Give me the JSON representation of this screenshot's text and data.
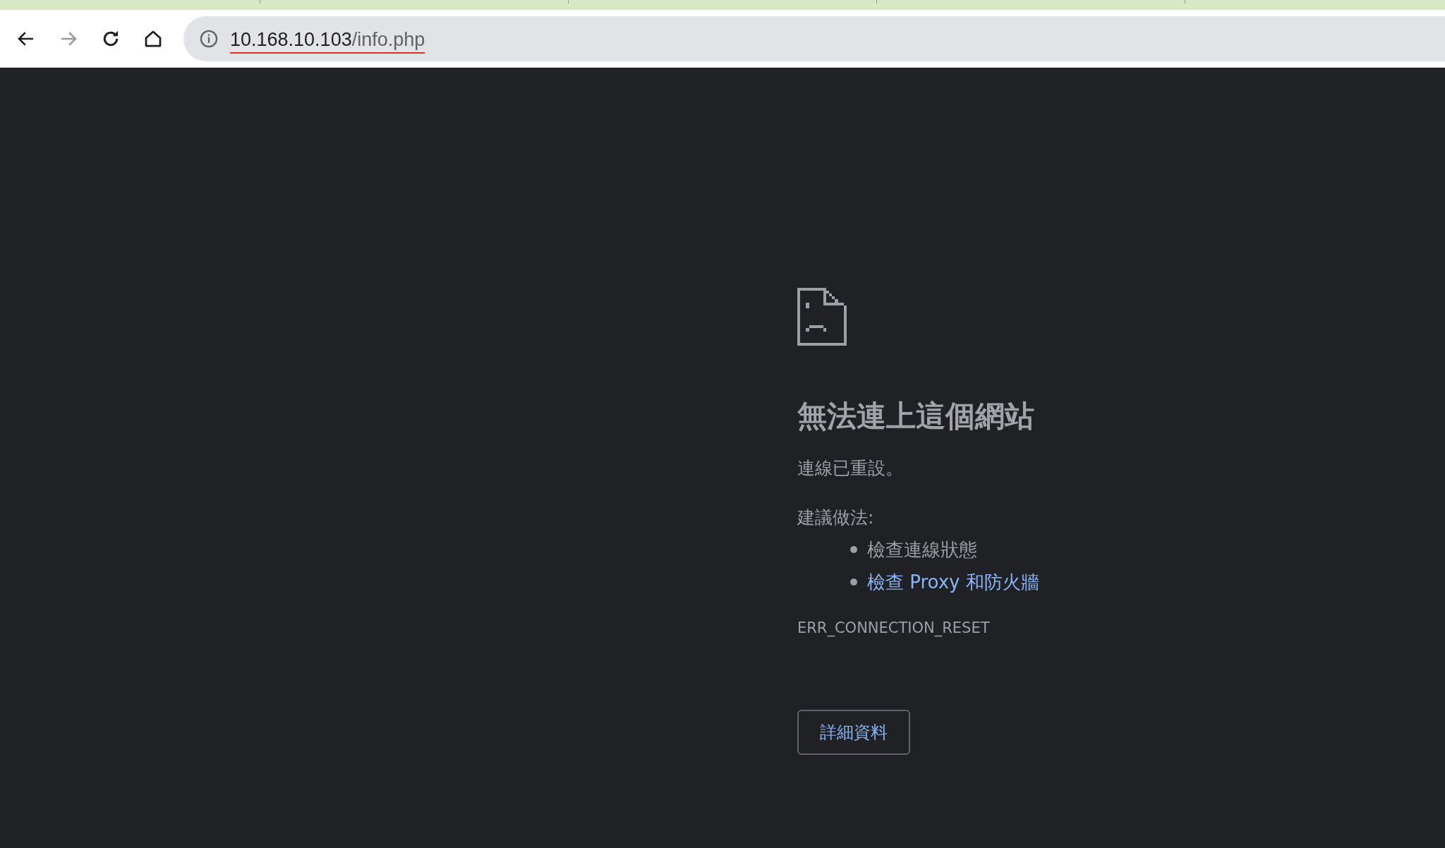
{
  "address_bar": {
    "host": "10.168.10.103",
    "path": "/info.php"
  },
  "error": {
    "title": "無法連上這個網站",
    "message": "連線已重設。",
    "suggestions_heading": "建議做法:",
    "suggestions": [
      {
        "text": "檢查連線狀態",
        "kind": "text"
      },
      {
        "text": "檢查 Proxy 和防火牆",
        "kind": "link"
      }
    ],
    "code": "ERR_CONNECTION_RESET",
    "details_button": "詳細資料"
  }
}
